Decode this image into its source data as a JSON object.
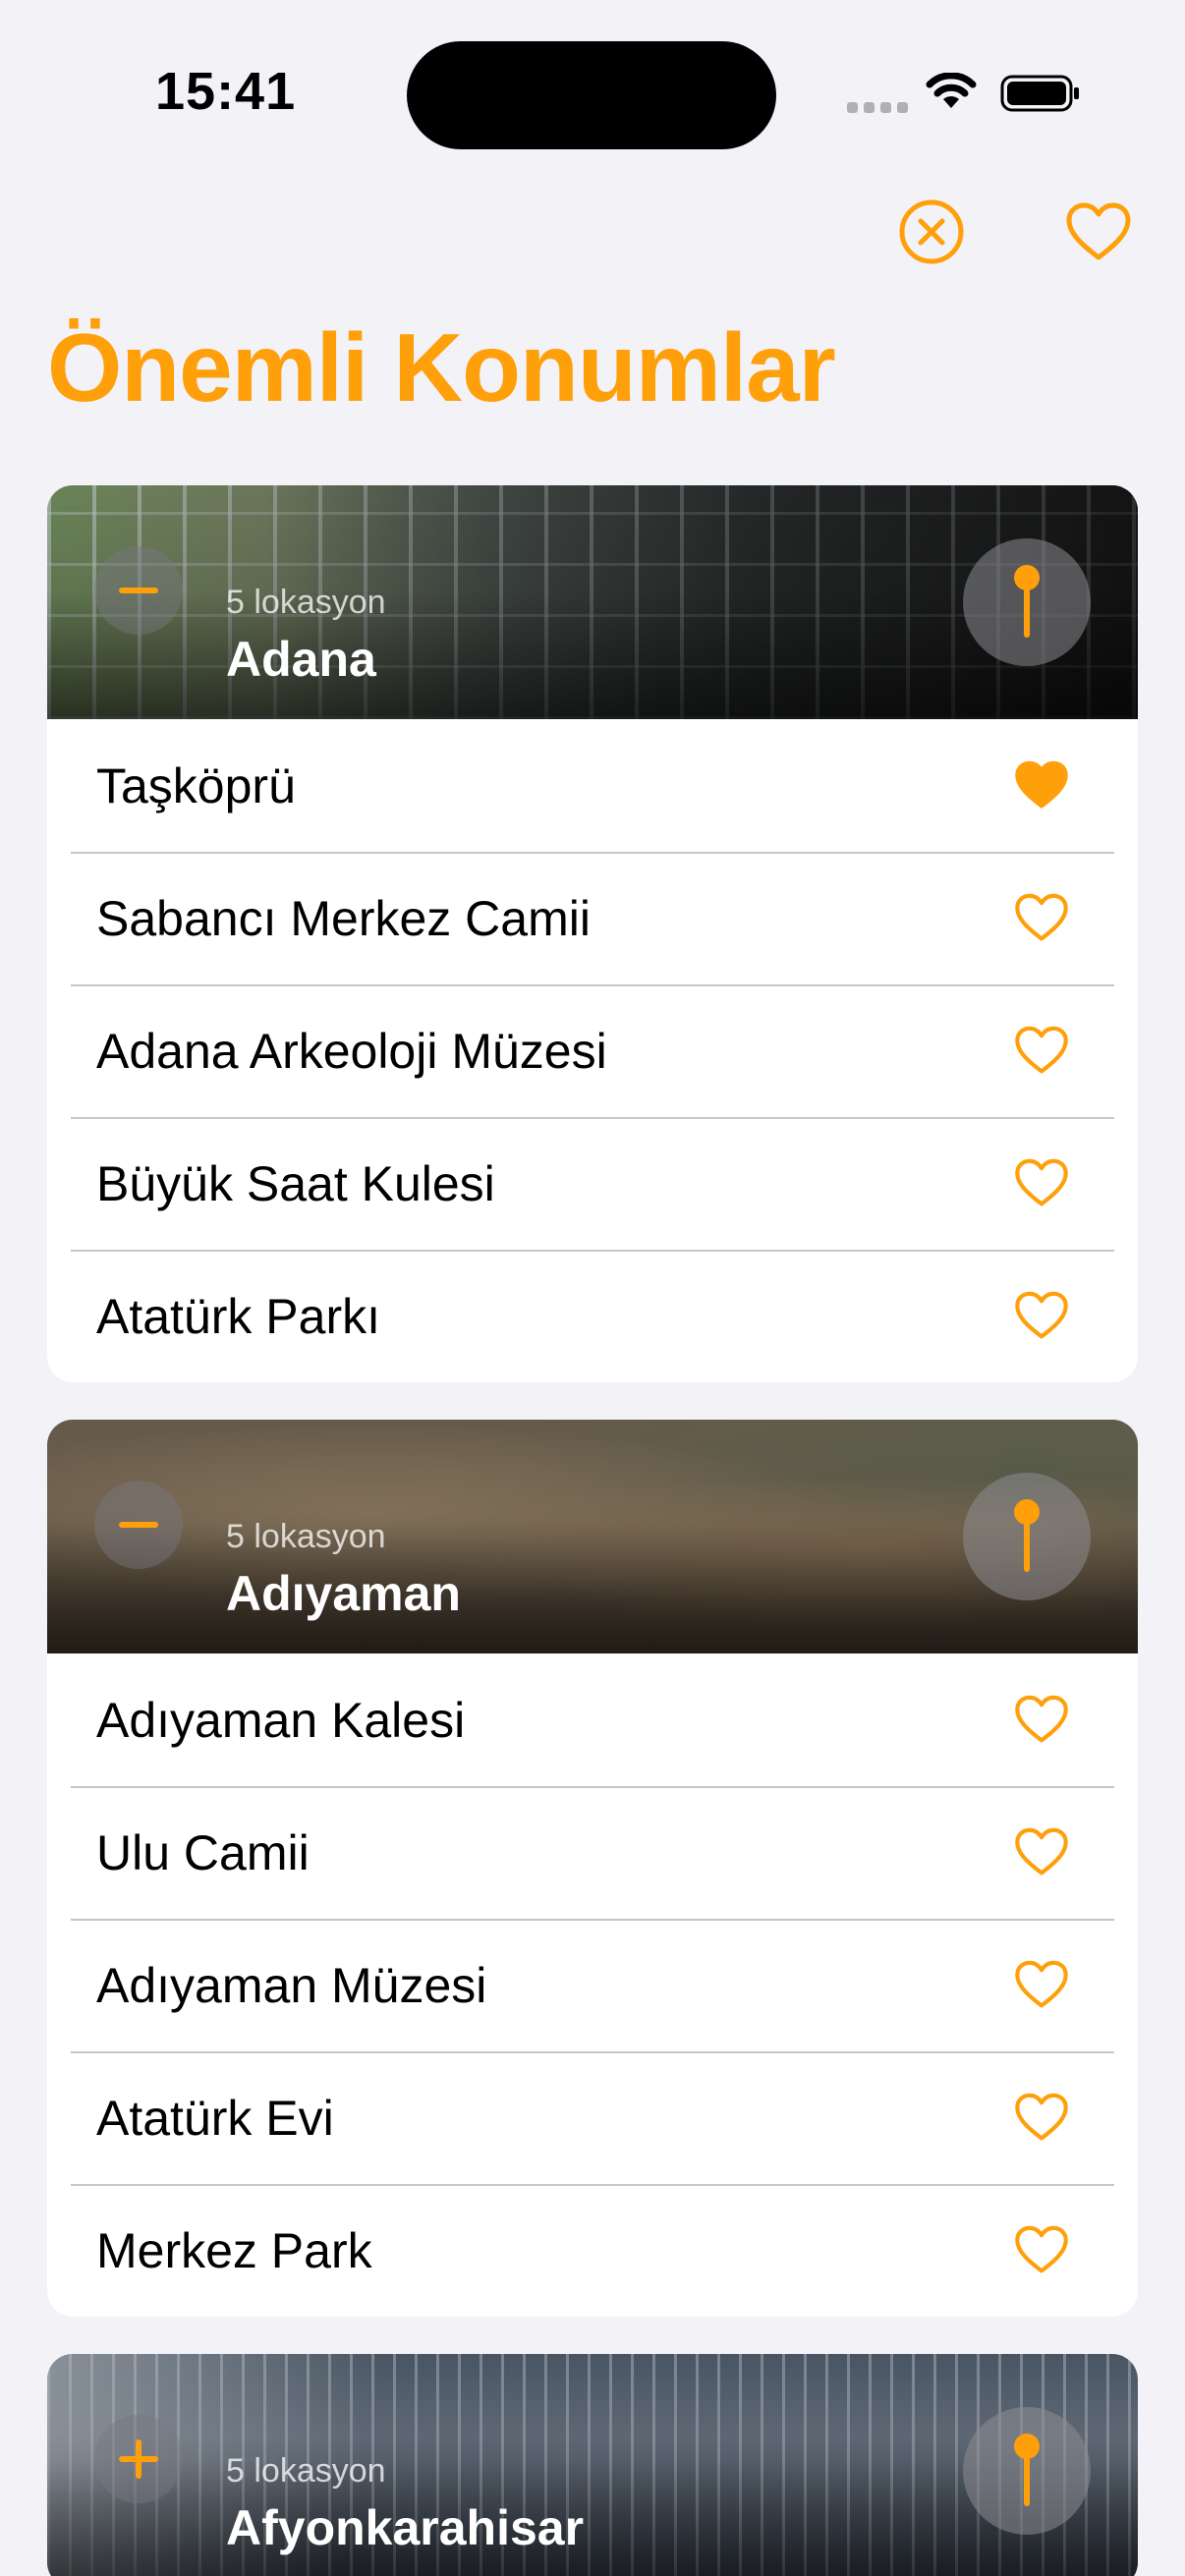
{
  "status_bar": {
    "time": "15:41"
  },
  "nav": {
    "close_icon": "xmark-circle-icon",
    "favorites_icon": "heart-outline-icon"
  },
  "page_title": "Önemli Konumlar",
  "colors": {
    "accent": "#ff9f0a",
    "background": "#f2f2f7"
  },
  "sections": [
    {
      "city": "Adana",
      "count_label": "5 lokasyon",
      "expanded": true,
      "items": [
        {
          "name": "Taşköprü",
          "favorite": true
        },
        {
          "name": "Sabancı Merkez Camii",
          "favorite": false
        },
        {
          "name": "Adana Arkeoloji Müzesi",
          "favorite": false
        },
        {
          "name": "Büyük Saat Kulesi",
          "favorite": false
        },
        {
          "name": "Atatürk Parkı",
          "favorite": false
        }
      ]
    },
    {
      "city": "Adıyaman",
      "count_label": "5 lokasyon",
      "expanded": true,
      "items": [
        {
          "name": "Adıyaman Kalesi",
          "favorite": false
        },
        {
          "name": "Ulu Camii",
          "favorite": false
        },
        {
          "name": "Adıyaman Müzesi",
          "favorite": false
        },
        {
          "name": "Atatürk Evi",
          "favorite": false
        },
        {
          "name": "Merkez Park",
          "favorite": false
        }
      ]
    },
    {
      "city": "Afyonkarahisar",
      "count_label": "5 lokasyon",
      "expanded": false,
      "items": []
    }
  ]
}
